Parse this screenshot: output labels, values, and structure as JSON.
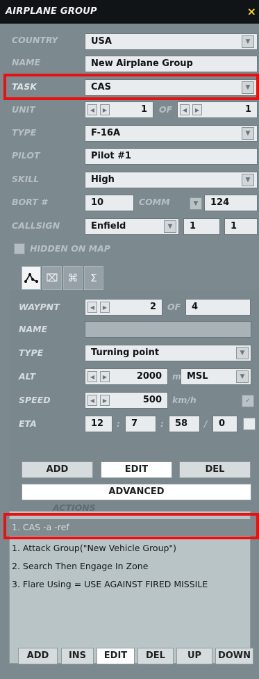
{
  "window": {
    "title": "AIRPLANE GROUP",
    "close": "×"
  },
  "fields": {
    "country": {
      "label": "COUNTRY",
      "value": "USA"
    },
    "name": {
      "label": "NAME",
      "value": "New Airplane Group"
    },
    "task": {
      "label": "TASK",
      "value": "CAS"
    },
    "unit": {
      "label": "UNIT",
      "value": "1",
      "of_label": "OF",
      "of_value": "1"
    },
    "type": {
      "label": "TYPE",
      "value": "F-16A"
    },
    "pilot": {
      "label": "PILOT",
      "value": "Pilot #1"
    },
    "skill": {
      "label": "SKILL",
      "value": "High"
    },
    "bort": {
      "label": "BORT #",
      "value": "10",
      "comm_label": "COMM",
      "comm_value": "124"
    },
    "callsign": {
      "label": "CALLSIGN",
      "value": "Enfield",
      "num1": "1",
      "num2": "1"
    },
    "hidden": {
      "label": "HIDDEN ON MAP"
    }
  },
  "tabs": {
    "t1": "ᨄ",
    "t2": "⌧",
    "t3": "⌘",
    "t4": "Σ"
  },
  "waypoint": {
    "waypnt_label": "WAYPNT",
    "waypnt_value": "2",
    "of_label": "OF",
    "of_value": "4",
    "name_label": "NAME",
    "name_value": "",
    "type_label": "TYPE",
    "type_value": "Turning point",
    "alt_label": "ALT",
    "alt_value": "2000",
    "alt_unit": "m",
    "alt_ref": "MSL",
    "speed_label": "SPEED",
    "speed_value": "500",
    "speed_unit": "km/h",
    "eta_label": "ETA",
    "eta_h": "12",
    "eta_m": "7",
    "eta_s": "58",
    "eta_d": "0",
    "sep_colon": ":",
    "sep_slash": "/"
  },
  "buttons": {
    "add": "ADD",
    "edit": "EDIT",
    "del": "DEL",
    "advanced": "ADVANCED"
  },
  "actions": {
    "header": "ACTIONS",
    "items": [
      "1. CAS -a -ref",
      "1. Attack Group(\"New Vehicle Group\")",
      "2. Search Then Engage In Zone",
      "3. Flare Using = USE AGAINST FIRED MISSILE"
    ]
  },
  "bottom_buttons": [
    "ADD",
    "INS",
    "EDIT",
    "DEL",
    "UP",
    "DOWN"
  ],
  "icons": {
    "dropdown": "chevron-down-icon",
    "spin_left": "arrow-left-icon",
    "spin_right": "arrow-right-icon",
    "close": "close-icon",
    "check": "check-icon"
  },
  "colors": {
    "panel_bg": "#7c898f",
    "titlebar_bg": "#101416",
    "close": "#ffd21a",
    "highlight": "#e8110f"
  }
}
